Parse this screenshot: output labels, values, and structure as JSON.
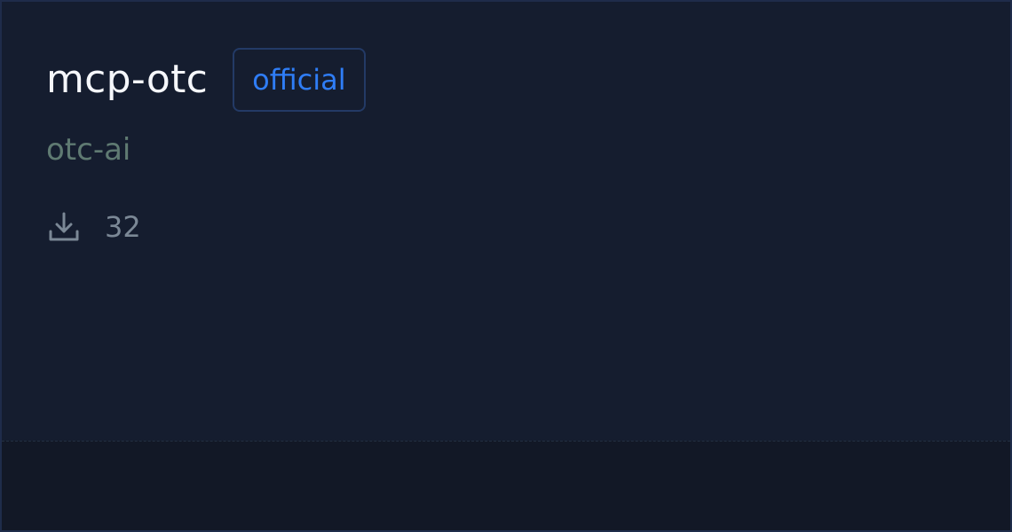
{
  "card": {
    "title": "mcp-otc",
    "badge": "official",
    "author": "otc-ai",
    "downloads": {
      "icon": "download-icon",
      "count": "32"
    }
  },
  "colors": {
    "background": "#151d2f",
    "border": "#1f2c4a",
    "badge_text": "#2f7df6",
    "author_text": "#5f7a72",
    "muted_text": "#7b8896",
    "footer": "#121826"
  }
}
